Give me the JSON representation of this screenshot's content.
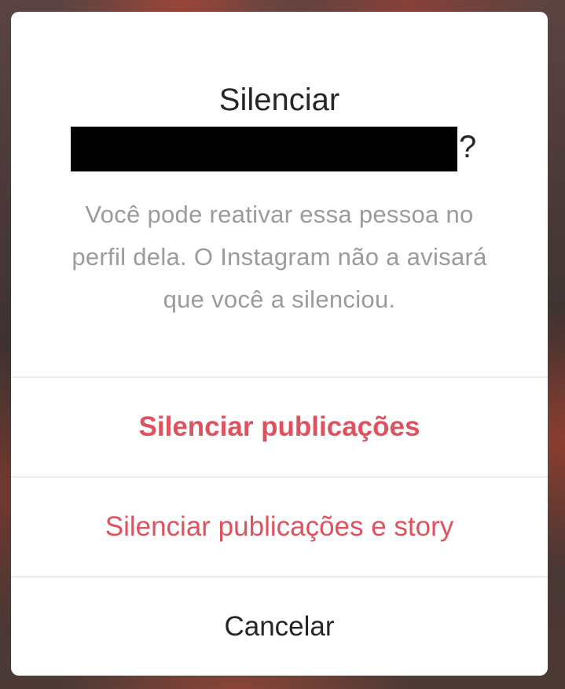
{
  "dialog": {
    "title": "Silenciar",
    "title_suffix": "?",
    "message": "Você pode reativar essa pessoa no perfil dela. O Instagram não a avisará que você a silenciou."
  },
  "actions": {
    "mute_posts_label": "Silenciar publicações",
    "mute_posts_story_label": "Silenciar publicações e story",
    "cancel_label": "Cancelar"
  },
  "colors": {
    "accent": "#e0515e",
    "text_primary": "#262626",
    "text_secondary": "#9b9b9b",
    "divider": "#dcdcdc",
    "redaction": "#000000"
  }
}
